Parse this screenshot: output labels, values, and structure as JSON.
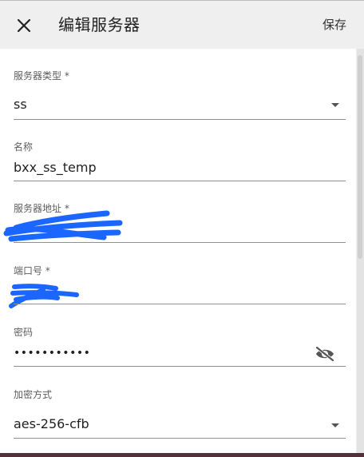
{
  "header": {
    "title": "编辑服务器",
    "save_label": "保存",
    "close_icon": "close-icon"
  },
  "form": {
    "server_type": {
      "label": "服务器类型 *",
      "value": "ss"
    },
    "name": {
      "label": "名称",
      "value": "bxx_ss_temp"
    },
    "server_address": {
      "label": "服务器地址 *",
      "value": ""
    },
    "port": {
      "label": "端口号 *",
      "value": ""
    },
    "password": {
      "label": "密码",
      "value": "•••••••••••"
    },
    "encryption": {
      "label": "加密方式",
      "value": "aes-256-cfb"
    }
  },
  "colors": {
    "scribble": "#1a66ff",
    "accent_underline": "#8f8f8f"
  },
  "icons": {
    "dropdown": "chevron-down-icon",
    "visibility": "eye-off-icon"
  }
}
